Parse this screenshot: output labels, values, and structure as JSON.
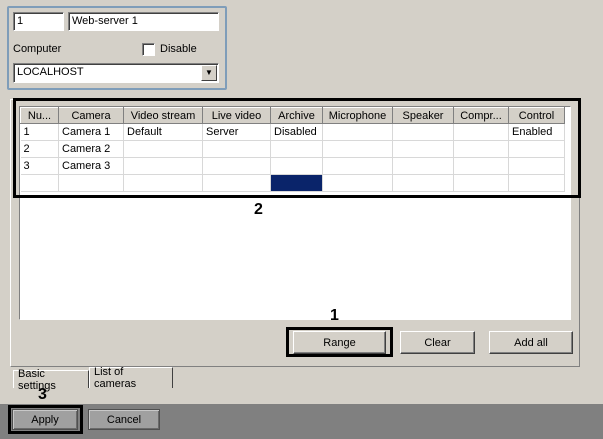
{
  "server": {
    "id": "1",
    "name": "Web-server 1",
    "computer_label": "Computer",
    "disable_label": "Disable",
    "computer_value": "LOCALHOST"
  },
  "table": {
    "columns": [
      "Nu...",
      "Camera",
      "Video stream",
      "Live video",
      "Archive",
      "Microphone",
      "Speaker",
      "Compr...",
      "Control"
    ],
    "rows": [
      [
        "1",
        "Camera 1",
        "Default",
        "Server",
        "Disabled",
        "",
        "",
        "",
        "Enabled"
      ],
      [
        "2",
        "Camera 2",
        "",
        "",
        "",
        "",
        "",
        "",
        ""
      ],
      [
        "3",
        "Camera 3",
        "",
        "",
        "",
        "",
        "",
        "",
        ""
      ]
    ]
  },
  "buttons": {
    "range": "Range",
    "clear": "Clear",
    "add_all": "Add all",
    "apply": "Apply",
    "cancel": "Cancel"
  },
  "tabs": {
    "basic": "Basic settings",
    "list": "List of cameras"
  },
  "callouts": {
    "one": "1",
    "two": "2",
    "three": "3"
  },
  "colors": {
    "selection": "#0a246a",
    "panel_border": "#7f9db9"
  }
}
